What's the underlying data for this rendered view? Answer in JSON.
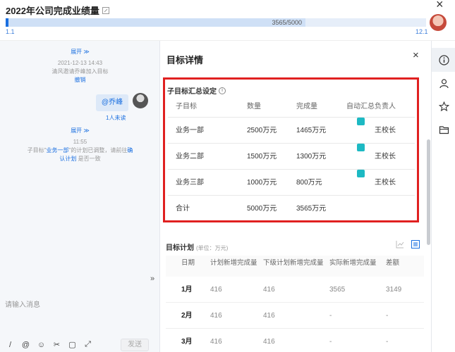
{
  "header": {
    "title": "2022年公司完成业绩量",
    "progress_label": "3565/5000",
    "progress_value": 0.713,
    "start_date": "1.1",
    "end_date": "12.1",
    "close_symbol": "×"
  },
  "chat": {
    "expand_label": "展开 ≫",
    "msg1_time": "2021-12-13 14:43",
    "msg1_text": "清风邀请乔峰加入目标",
    "msg1_revoke": "撤销",
    "bubble_text": "@乔峰",
    "unread": "1人未读",
    "expand_label2": "展开 ≫",
    "msg2_time": "11:55",
    "msg2_prefix": "子目标\"",
    "msg2_target": "业务一部",
    "msg2_mid": "\"的计划已调整，请前往",
    "msg2_link1": "确",
    "msg2_link2": "认计划",
    "msg2_suffix": "是否一致",
    "collapse_arrow": "»",
    "input_placeholder": "请输入消息",
    "send_label": "发送",
    "toolbar": [
      "/",
      "@",
      "☺",
      "✂",
      "▢",
      "⤢"
    ]
  },
  "panel": {
    "title": "目标详情",
    "close_symbol": "×",
    "subgoal_title": "子目标汇总设定",
    "subgoal_headers": {
      "c1": "子目标",
      "c2": "数量",
      "c3": "完成量",
      "c4": "自动汇总",
      "c5": "负责人"
    },
    "subgoal_rows": [
      {
        "name": "业务一部",
        "qty": "2500万元",
        "done": "1465万元",
        "auto": true,
        "owner": "王校长"
      },
      {
        "name": "业务二部",
        "qty": "1500万元",
        "done": "1300万元",
        "auto": true,
        "owner": "王校长"
      },
      {
        "name": "业务三部",
        "qty": "1000万元",
        "done": "800万元",
        "auto": true,
        "owner": "王校长"
      },
      {
        "name": "合计",
        "qty": "5000万元",
        "done": "3565万元",
        "auto": false,
        "owner": ""
      }
    ],
    "plan_title": "目标计划",
    "plan_unit": "(单位：万元)",
    "plan_headers": {
      "p1": "日期",
      "p2": "计划新增完成量",
      "p3": "下级计划新增完成量",
      "p4": "实际新增完成量",
      "p5": "差额"
    },
    "plan_rows": [
      {
        "month": "1月",
        "plan": "416",
        "sub": "416",
        "actual": "3565",
        "diff": "3149"
      },
      {
        "month": "2月",
        "plan": "416",
        "sub": "416",
        "actual": "-",
        "diff": "-"
      },
      {
        "month": "3月",
        "plan": "416",
        "sub": "416",
        "actual": "-",
        "diff": "-"
      }
    ]
  },
  "colors": {
    "accent": "#1a6fe0",
    "highlight_border": "#e02020",
    "checkbox": "#1db9c3"
  }
}
